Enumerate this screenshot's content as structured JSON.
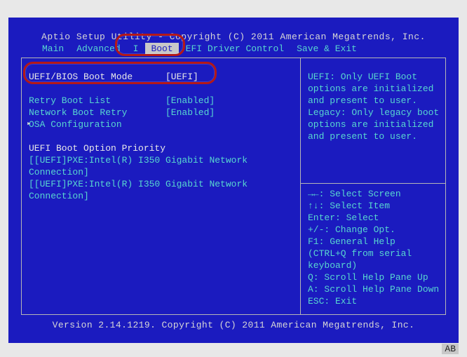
{
  "header": "Aptio Setup Utility - Copyright (C) 2011 American Megatrends, Inc.",
  "menu": {
    "items": [
      {
        "label": "Main"
      },
      {
        "label": "Advanced"
      },
      {
        "label": "I"
      },
      {
        "label": "Boot"
      },
      {
        "label": "EFI Driver Control"
      },
      {
        "label": "Save & Exit"
      }
    ]
  },
  "boot": {
    "mode": {
      "label": "UEFI/BIOS Boot Mode",
      "value": "[UEFI]"
    },
    "retry": {
      "label": "Retry Boot List",
      "value": "[Enabled]"
    },
    "network": {
      "label": "Network Boot Retry",
      "value": "[Enabled]"
    },
    "osa": {
      "label": "OSA Configuration"
    },
    "priority_heading": "UEFI Boot Option Priority",
    "entries": [
      "[[UEFI]PXE:Intel(R) I350 Gigabit Network Connection]",
      "[[UEFI]PXE:Intel(R) I350 Gigabit Network Connection]"
    ]
  },
  "help": {
    "text": "UEFI: Only UEFI Boot options are initialized and present to user. Legacy: Only legacy boot options are initialized and present to user.",
    "keys": [
      "→←: Select Screen",
      "↑↓: Select Item",
      "Enter: Select",
      "+/-: Change Opt.",
      "F1: General Help",
      " (CTRL+Q from serial",
      " keyboard)",
      "Q: Scroll Help Pane Up",
      "A: Scroll Help Pane Down",
      "ESC: Exit"
    ]
  },
  "footer": "Version 2.14.1219. Copyright (C) 2011 American Megatrends, Inc.",
  "badge": "AB"
}
